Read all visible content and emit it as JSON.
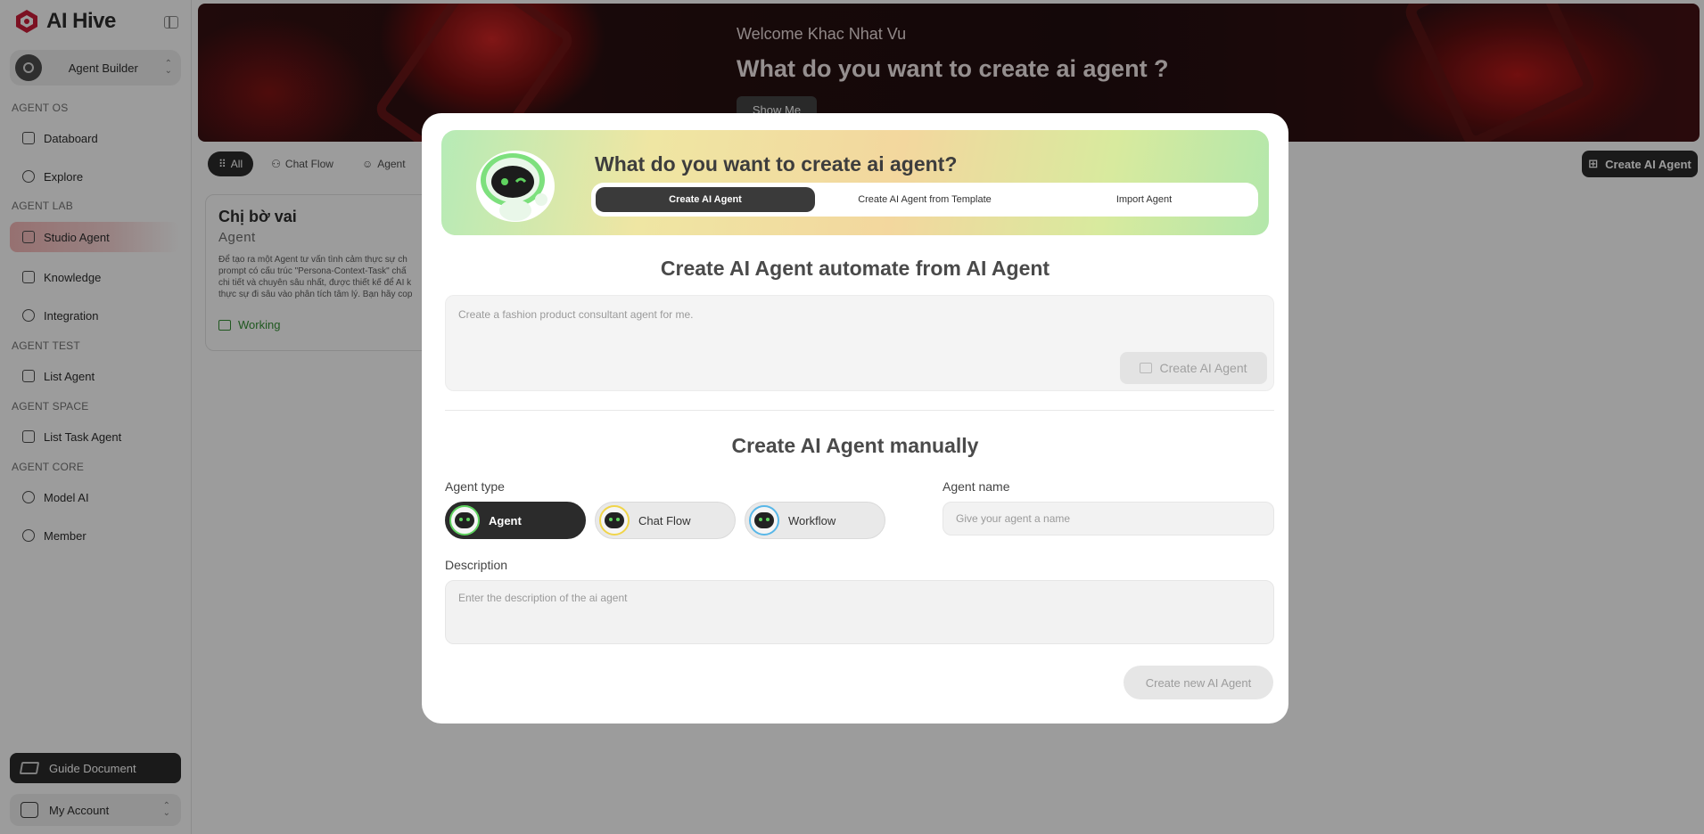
{
  "app": {
    "logo_text": "AI Hive"
  },
  "sidebar": {
    "workspace": "Agent Builder",
    "sections": [
      {
        "title": "AGENT OS",
        "items": [
          "Databoard",
          "Explore"
        ]
      },
      {
        "title": "AGENT LAB",
        "items": [
          "Studio Agent",
          "Knowledge",
          "Integration"
        ]
      },
      {
        "title": "AGENT TEST",
        "items": [
          "List Agent"
        ]
      },
      {
        "title": "AGENT SPACE",
        "items": [
          "List Task Agent"
        ]
      },
      {
        "title": "AGENT CORE",
        "items": [
          "Model AI",
          "Member"
        ]
      }
    ],
    "active_item": "Studio Agent",
    "guide_label": "Guide Document",
    "account_label": "My Account"
  },
  "banner": {
    "welcome": "Welcome Khac Nhat Vu",
    "title": "What do you want to create ai agent ?",
    "button": "Show Me"
  },
  "filters": {
    "all": "All",
    "chat_flow": "Chat Flow",
    "agent": "Agent"
  },
  "create_top_button": "Create AI Agent",
  "card": {
    "title": "Chị bờ vai",
    "subtitle": "Agent",
    "desc_lines": [
      "Để tạo ra một Agent tư vấn tình cảm thực sự ch",
      "prompt có cấu trúc \"Persona-Context-Task\" chấ",
      "chi tiết và chuyên sâu nhất, được thiết kế để AI k",
      "thực sự đi sâu vào phân tích tâm lý. Bạn hãy cop"
    ],
    "status": "Working"
  },
  "modal": {
    "hero_title": "What do you want to create ai agent?",
    "tabs": [
      "Create AI Agent",
      "Create AI Agent from Template",
      "Import Agent"
    ],
    "active_tab": "Create AI Agent",
    "auto_title": "Create AI Agent automate from AI Agent",
    "auto_placeholder": "Create a fashion product consultant agent for me.",
    "auto_button": "Create AI Agent",
    "manual_title": "Create AI Agent manually",
    "agent_type_label": "Agent type",
    "agent_types": [
      "Agent",
      "Chat Flow",
      "Workflow"
    ],
    "selected_type": "Agent",
    "agent_name_label": "Agent name",
    "agent_name_placeholder": "Give your agent a name",
    "description_label": "Description",
    "description_placeholder": "Enter the description of the ai agent",
    "create_button": "Create new AI Agent"
  }
}
